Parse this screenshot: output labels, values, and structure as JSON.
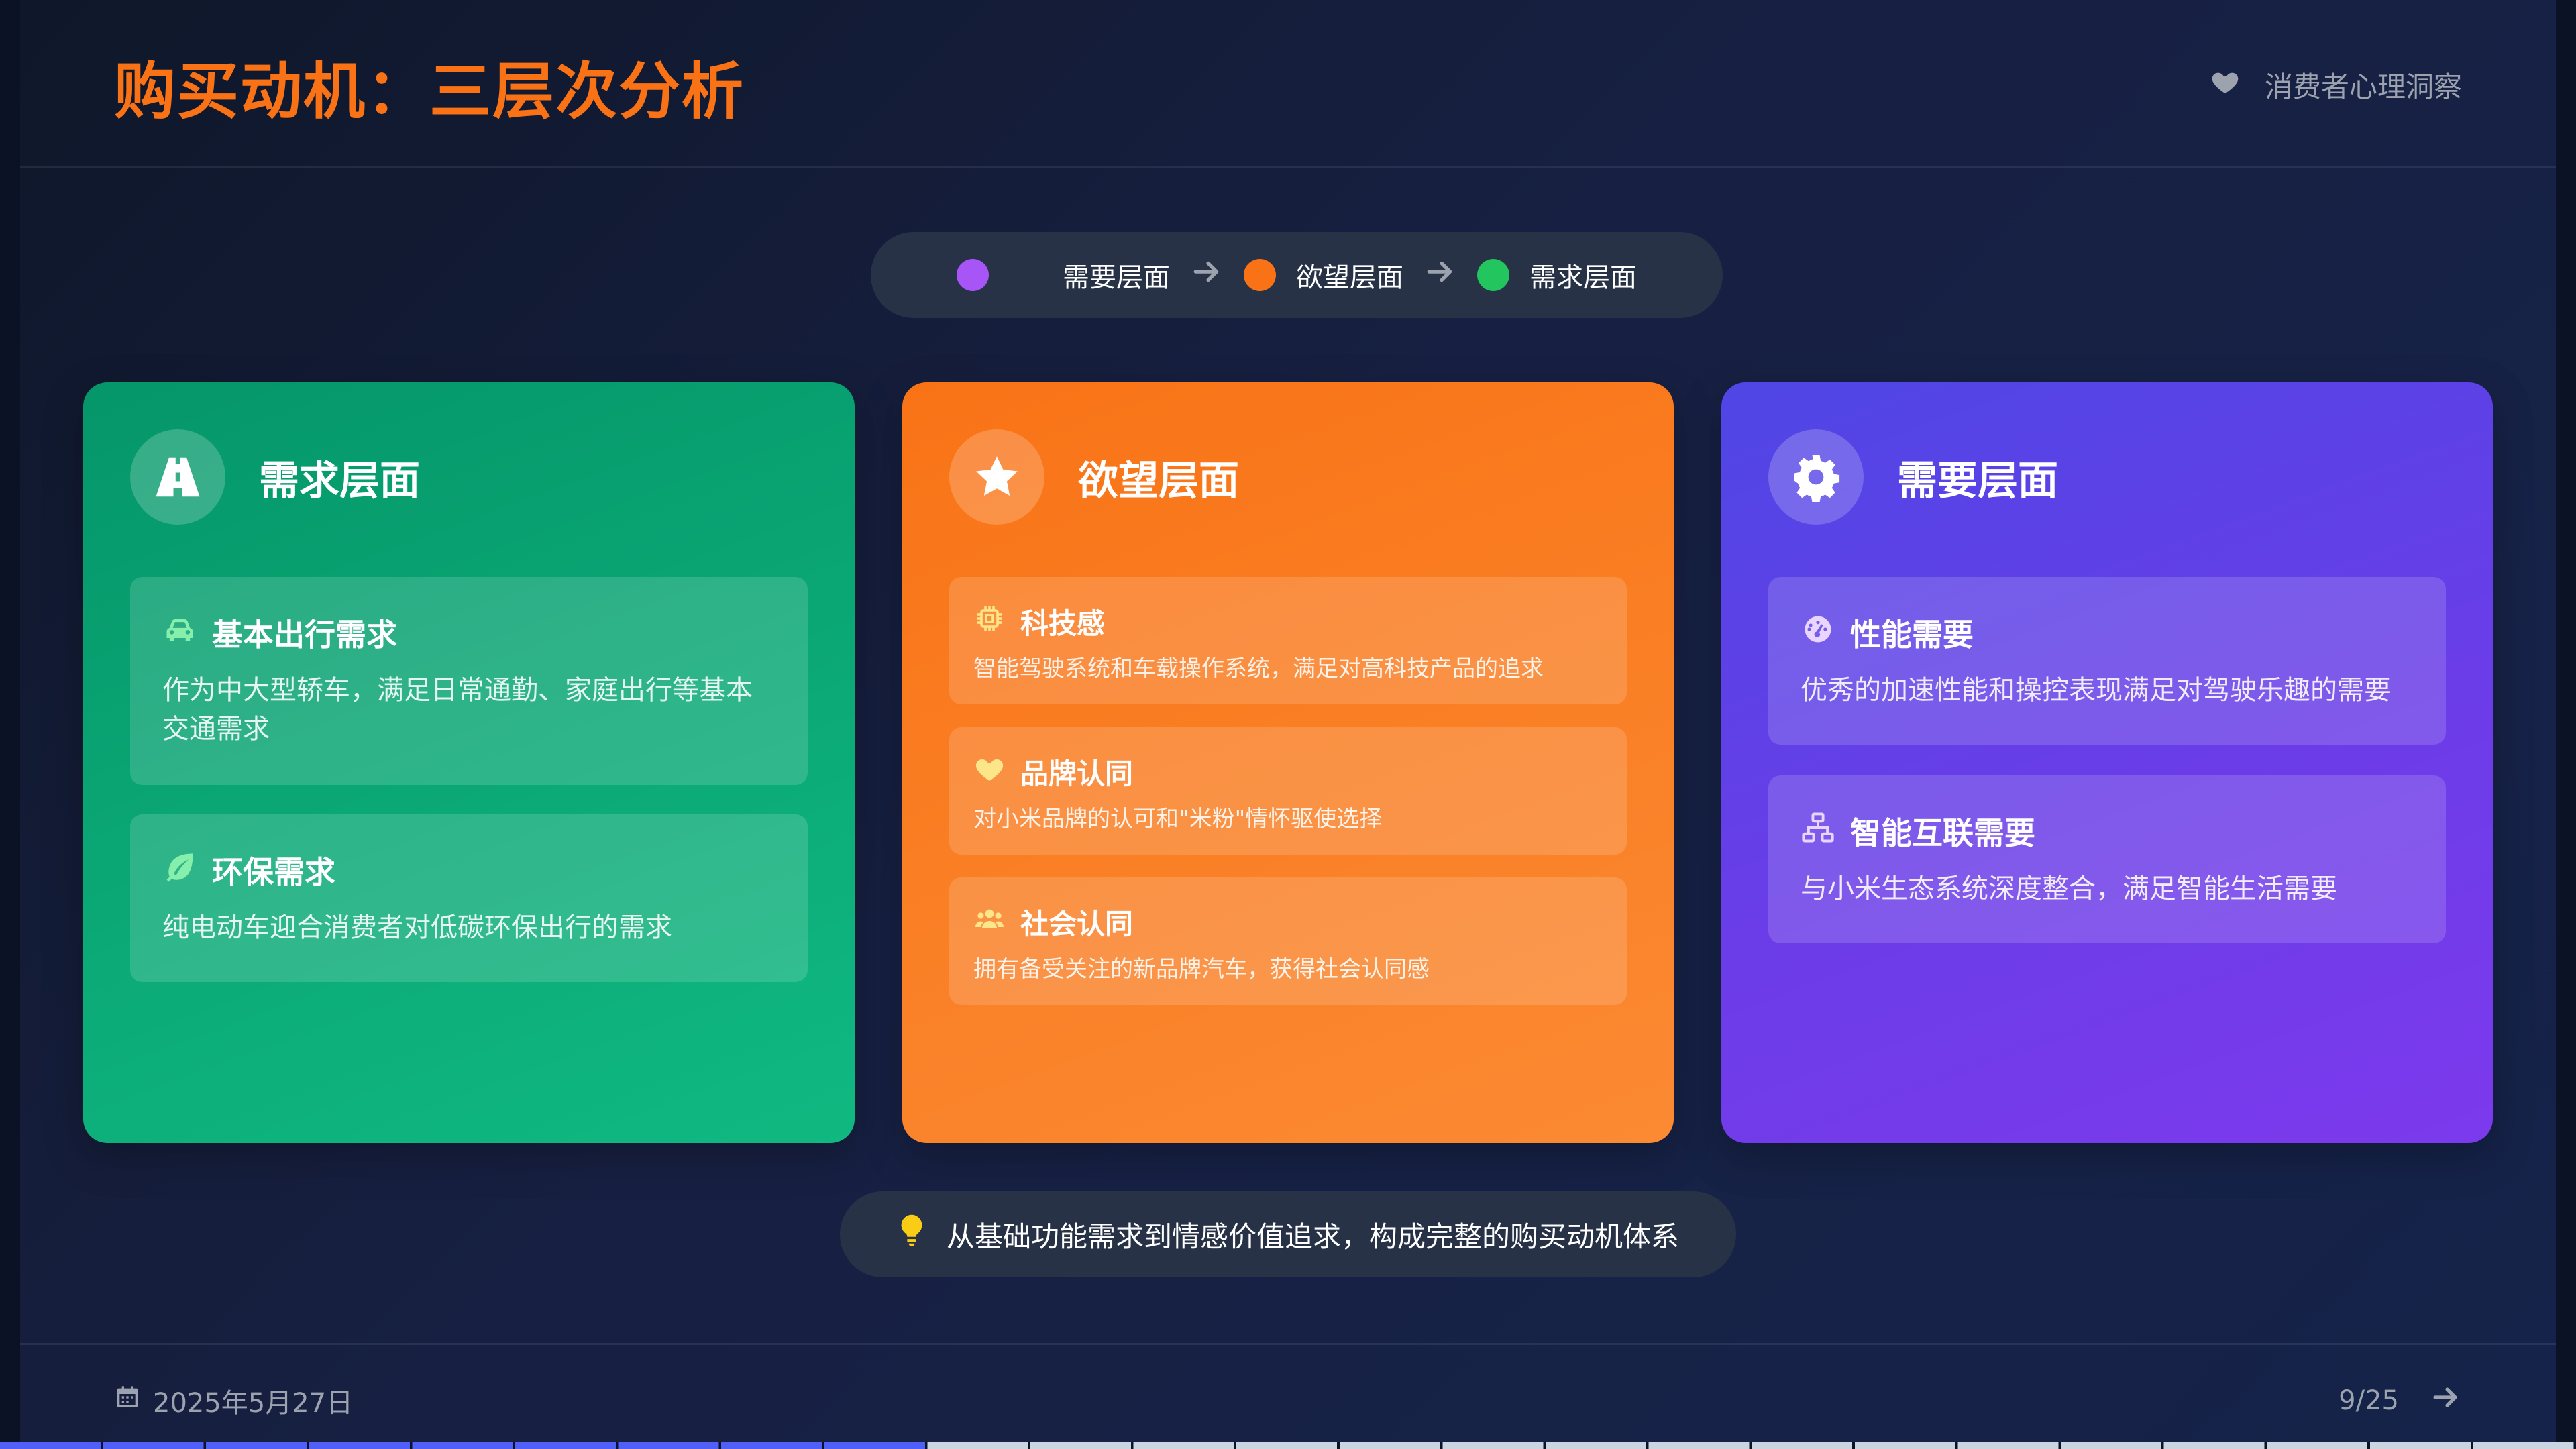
{
  "header": {
    "title": "购买动机：三层次分析",
    "tag": "消费者心理洞察",
    "tag_icon": "heart-icon"
  },
  "flow": {
    "steps": [
      {
        "label": "需要层面",
        "color": "#a855f7"
      },
      {
        "label": "欲望层面",
        "color": "#f97316"
      },
      {
        "label": "需求层面",
        "color": "#22c55e"
      }
    ]
  },
  "cards": [
    {
      "title": "需求层面",
      "icon": "road-icon",
      "color": "#10b981",
      "items": [
        {
          "icon": "car-icon",
          "title": "基本出行需求",
          "desc": "作为中大型轿车，满足日常通勤、家庭出行等基本交通需求"
        },
        {
          "icon": "leaf-icon",
          "title": "环保需求",
          "desc": "纯电动车迎合消费者对低碳环保出行的需求"
        }
      ]
    },
    {
      "title": "欲望层面",
      "icon": "star-icon",
      "color": "#f97316",
      "items": [
        {
          "icon": "chip-icon",
          "title": "科技感",
          "desc": "智能驾驶系统和车载操作系统，满足对高科技产品的追求"
        },
        {
          "icon": "heart-icon",
          "title": "品牌认同",
          "desc": "对小米品牌的认可和\"米粉\"情怀驱使选择"
        },
        {
          "icon": "users-icon",
          "title": "社会认同",
          "desc": "拥有备受关注的新品牌汽车，获得社会认同感"
        }
      ]
    },
    {
      "title": "需要层面",
      "icon": "gear-icon",
      "color": "#6d3ce8",
      "items": [
        {
          "icon": "gauge-icon",
          "title": "性能需要",
          "desc": "优秀的加速性能和操控表现满足对驾驶乐趣的需要"
        },
        {
          "icon": "network-icon",
          "title": "智能互联需要",
          "desc": "与小米生态系统深度整合，满足智能生活需要"
        }
      ]
    }
  ],
  "insight": {
    "icon": "lightbulb-icon",
    "text": "从基础功能需求到情感价值追求，构成完整的购买动机体系"
  },
  "footer": {
    "date": "2025年5月27日",
    "page": "9/25",
    "progress": 0.36
  }
}
